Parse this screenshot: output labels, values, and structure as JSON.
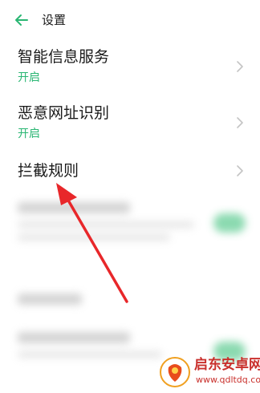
{
  "header": {
    "title": "设置",
    "back_icon": "arrow-left-icon"
  },
  "accent_color": "#2ab673",
  "items": [
    {
      "label": "智能信息服务",
      "status": "开启"
    },
    {
      "label": "恶意网址识别",
      "status": "开启"
    },
    {
      "label": "拦截规则"
    }
  ],
  "watermark": {
    "title": "启东安卓网",
    "url": "www.qdltdq.com"
  }
}
